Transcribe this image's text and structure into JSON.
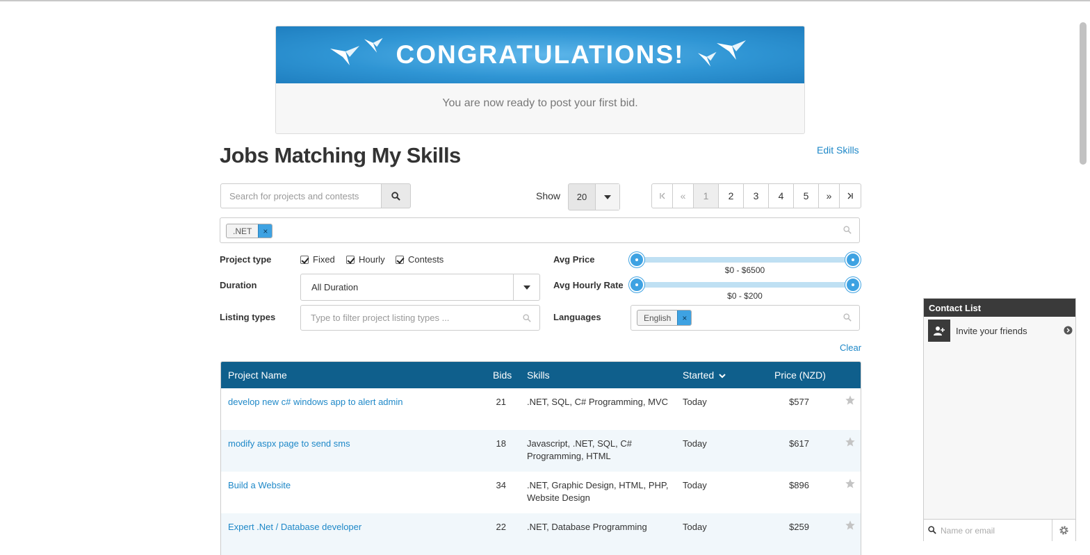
{
  "banner": {
    "title": "CONGRATULATIONS!",
    "subtitle": "You are now ready to post your first bid."
  },
  "page": {
    "title": "Jobs Matching My Skills",
    "edit_skills": "Edit Skills"
  },
  "search": {
    "placeholder": "Search for projects and contests",
    "icon": "search-icon"
  },
  "show": {
    "label": "Show",
    "value": "20"
  },
  "pagination": {
    "first": "«",
    "prev": "«",
    "pages": [
      "1",
      "2",
      "3",
      "4",
      "5"
    ],
    "current": "1",
    "next": "»",
    "last": "»"
  },
  "skills_filter": {
    "tag": ".NET",
    "remove": "×"
  },
  "filters": {
    "project_type_label": "Project type",
    "fixed": "Fixed",
    "hourly": "Hourly",
    "contests": "Contests",
    "duration_label": "Duration",
    "duration_value": "All Duration",
    "listing_label": "Listing types",
    "listing_placeholder": "Type to filter project listing types ...",
    "avg_price_label": "Avg Price",
    "avg_price_range": "$0 - $6500",
    "avg_hourly_label": "Avg Hourly Rate",
    "avg_hourly_range": "$0 - $200",
    "languages_label": "Languages",
    "language_tag": "English",
    "clear": "Clear"
  },
  "table": {
    "headers": {
      "name": "Project Name",
      "bids": "Bids",
      "skills": "Skills",
      "started": "Started",
      "price": "Price (NZD)"
    },
    "rows": [
      {
        "name": "develop new c# windows app to alert admin",
        "bids": "21",
        "skills": ".NET, SQL, C# Programming, MVC",
        "started": "Today",
        "price": "$577"
      },
      {
        "name": "modify aspx page to send sms",
        "bids": "18",
        "skills": "Javascript, .NET, SQL, C# Programming, HTML",
        "started": "Today",
        "price": "$617"
      },
      {
        "name": "Build a Website",
        "bids": "34",
        "skills": ".NET, Graphic Design, HTML, PHP, Website Design",
        "started": "Today",
        "price": "$896"
      },
      {
        "name": "Expert .Net / Database developer",
        "bids": "22",
        "skills": ".NET, Database Programming",
        "started": "Today",
        "price": "$259"
      }
    ]
  },
  "contacts": {
    "title": "Contact List",
    "invite": "Invite your friends",
    "search_placeholder": "Name or email"
  },
  "colors": {
    "accent": "#1e88c8",
    "table_header": "#0f5f8c",
    "banner": "#2f95d4"
  }
}
